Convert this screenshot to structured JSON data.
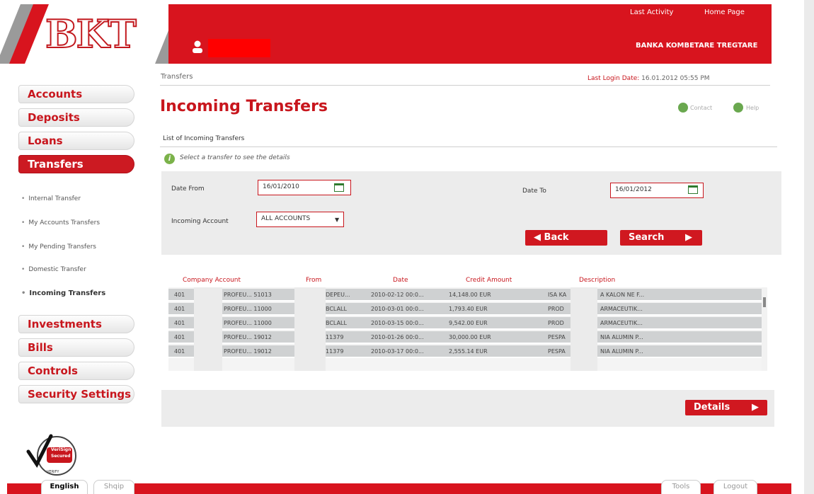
{
  "header": {
    "logo_text": "BKT",
    "last_activity": "Last Activity",
    "home_page": "Home Page",
    "bank_name": "BANKA KOMBETARE TREGTARE",
    "brand_red": "#d8141e"
  },
  "sidebar": {
    "items": [
      {
        "label": "Accounts"
      },
      {
        "label": "Deposits"
      },
      {
        "label": "Loans"
      },
      {
        "label": "Transfers"
      }
    ],
    "sub_items": [
      {
        "label": "Internal Transfer"
      },
      {
        "label": "My Accounts Transfers"
      },
      {
        "label": "My Pending Transfers"
      },
      {
        "label": "Domestic Transfer"
      },
      {
        "label": "Incoming Transfers"
      }
    ],
    "bottom_items": [
      {
        "label": "Investments"
      },
      {
        "label": "Bills"
      },
      {
        "label": "Controls"
      },
      {
        "label": "Security Settings"
      }
    ]
  },
  "main": {
    "breadcrumb": "Transfers",
    "last_login_label": "Last Login Date:",
    "last_login_value": "16.01.2012 05:55 PM",
    "title": "Incoming Transfers",
    "contact": "Contact",
    "help": "Help",
    "section_label": "List of Incoming Transfers",
    "info_text": "Select a transfer to see the details",
    "filters": {
      "date_from_label": "Date From",
      "date_from_value": "16/01/2010",
      "date_to_label": "Date To",
      "date_to_value": "16/01/2012",
      "account_label": "Incoming Account",
      "account_value": "ALL ACCOUNTS"
    },
    "back_label": "Back",
    "search_label": "Search",
    "details_label": "Details",
    "table": {
      "headers": [
        "Company Account",
        "From",
        "Date",
        "Credit Amount",
        "Description"
      ],
      "rows": [
        {
          "account": "401",
          "prod": "PROFEU... 51013",
          "from": "DEPEU...",
          "date": "2010-02-12 00:0...",
          "amount": "14,148.00 EUR",
          "desc_a": "ISA KA",
          "desc_b": "A KALON NE F..."
        },
        {
          "account": "401",
          "prod": "PROFEU... 11000",
          "from": "BCLALL",
          "date": "2010-03-01 00:0...",
          "amount": "1,793.40 EUR",
          "desc_a": "PROD",
          "desc_b": "ARMACEUTIK..."
        },
        {
          "account": "401",
          "prod": "PROFEU... 11000",
          "from": "BCLALL",
          "date": "2010-03-15 00:0...",
          "amount": "9,542.00 EUR",
          "desc_a": "PROD",
          "desc_b": "ARMACEUTIK..."
        },
        {
          "account": "401",
          "prod": "PROFEU... 19012",
          "from": "11379",
          "date": "2010-01-26 00:0...",
          "amount": "30,000.00 EUR",
          "desc_a": "PESPA",
          "desc_b": "NIA ALUMIN P..."
        },
        {
          "account": "401",
          "prod": "PROFEU... 19012",
          "from": "11379",
          "date": "2010-03-17 00:0...",
          "amount": "2,555.14 EUR",
          "desc_a": "PESPA",
          "desc_b": "NIA ALUMIN P..."
        }
      ]
    }
  },
  "footer": {
    "verisign_line1": "VeriSign",
    "verisign_line2": "Secured",
    "verisign_line3": "VERIFY",
    "english": "English",
    "shqip": "Shqip",
    "tools": "Tools",
    "logout": "Logout"
  }
}
